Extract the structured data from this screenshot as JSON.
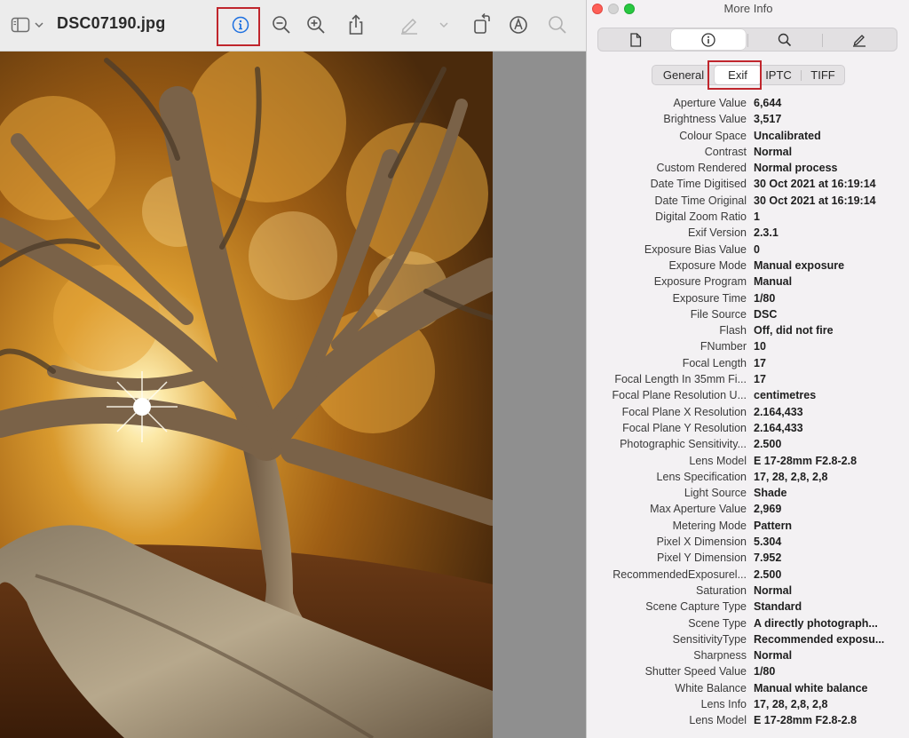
{
  "preview": {
    "document_title": "DSC07190.jpg",
    "toolbar_icons": [
      "sidebar-icon",
      "chevron-down-icon",
      "info-icon",
      "zoom-out-icon",
      "zoom-in-icon",
      "share-icon",
      "markup-pen-icon",
      "chevron-down-icon",
      "rotate-icon",
      "markup-circle-icon",
      "search-icon"
    ]
  },
  "info_panel": {
    "window_title": "More Info",
    "main_tabs": [
      "document-icon",
      "info-icon",
      "search-icon",
      "pen-icon"
    ],
    "active_main_tab": "info-icon",
    "subtabs": [
      "General",
      "Exif",
      "IPTC",
      "TIFF"
    ],
    "active_subtab": "Exif",
    "rows": [
      {
        "key": "Aperture Value",
        "value": "6,644"
      },
      {
        "key": "Brightness Value",
        "value": "3,517"
      },
      {
        "key": "Colour Space",
        "value": "Uncalibrated"
      },
      {
        "key": "Contrast",
        "value": "Normal"
      },
      {
        "key": "Custom Rendered",
        "value": "Normal process"
      },
      {
        "key": "Date Time Digitised",
        "value": "30 Oct 2021 at 16:19:14"
      },
      {
        "key": "Date Time Original",
        "value": "30 Oct 2021 at 16:19:14"
      },
      {
        "key": "Digital Zoom Ratio",
        "value": "1"
      },
      {
        "key": "Exif Version",
        "value": "2.3.1"
      },
      {
        "key": "Exposure Bias Value",
        "value": "0"
      },
      {
        "key": "Exposure Mode",
        "value": "Manual exposure"
      },
      {
        "key": "Exposure Program",
        "value": "Manual"
      },
      {
        "key": "Exposure Time",
        "value": "1/80"
      },
      {
        "key": "File Source",
        "value": "DSC"
      },
      {
        "key": "Flash",
        "value": "Off, did not fire"
      },
      {
        "key": "FNumber",
        "value": "10"
      },
      {
        "key": "Focal Length",
        "value": "17"
      },
      {
        "key": "Focal Length In 35mm Fi...",
        "value": "17"
      },
      {
        "key": "Focal Plane Resolution U...",
        "value": "centimetres"
      },
      {
        "key": "Focal Plane X Resolution",
        "value": "2.164,433"
      },
      {
        "key": "Focal Plane Y Resolution",
        "value": "2.164,433"
      },
      {
        "key": "Photographic Sensitivity...",
        "value": "2.500"
      },
      {
        "key": "Lens Model",
        "value": "E 17-28mm F2.8-2.8"
      },
      {
        "key": "Lens Specification",
        "value": "17, 28, 2,8, 2,8"
      },
      {
        "key": "Light Source",
        "value": "Shade"
      },
      {
        "key": "Max Aperture Value",
        "value": "2,969"
      },
      {
        "key": "Metering Mode",
        "value": "Pattern"
      },
      {
        "key": "Pixel X Dimension",
        "value": "5.304"
      },
      {
        "key": "Pixel Y Dimension",
        "value": "7.952"
      },
      {
        "key": "RecommendedExposurel...",
        "value": "2.500"
      },
      {
        "key": "Saturation",
        "value": "Normal"
      },
      {
        "key": "Scene Capture Type",
        "value": "Standard"
      },
      {
        "key": "Scene Type",
        "value": "A directly photograph..."
      },
      {
        "key": "SensitivityType",
        "value": "Recommended exposu..."
      },
      {
        "key": "Sharpness",
        "value": "Normal"
      },
      {
        "key": "Shutter Speed Value",
        "value": "1/80"
      },
      {
        "key": "White Balance",
        "value": "Manual white balance"
      },
      {
        "key": "Lens Info",
        "value": "17, 28, 2,8, 2,8"
      },
      {
        "key": "Lens Model",
        "value": "E 17-28mm F2.8-2.8"
      }
    ]
  },
  "colors": {
    "highlight_box": "#c0262d",
    "active_toolbar_icon": "#1c6fe0",
    "traffic_red": "#fe5f57",
    "traffic_green": "#28c840"
  }
}
